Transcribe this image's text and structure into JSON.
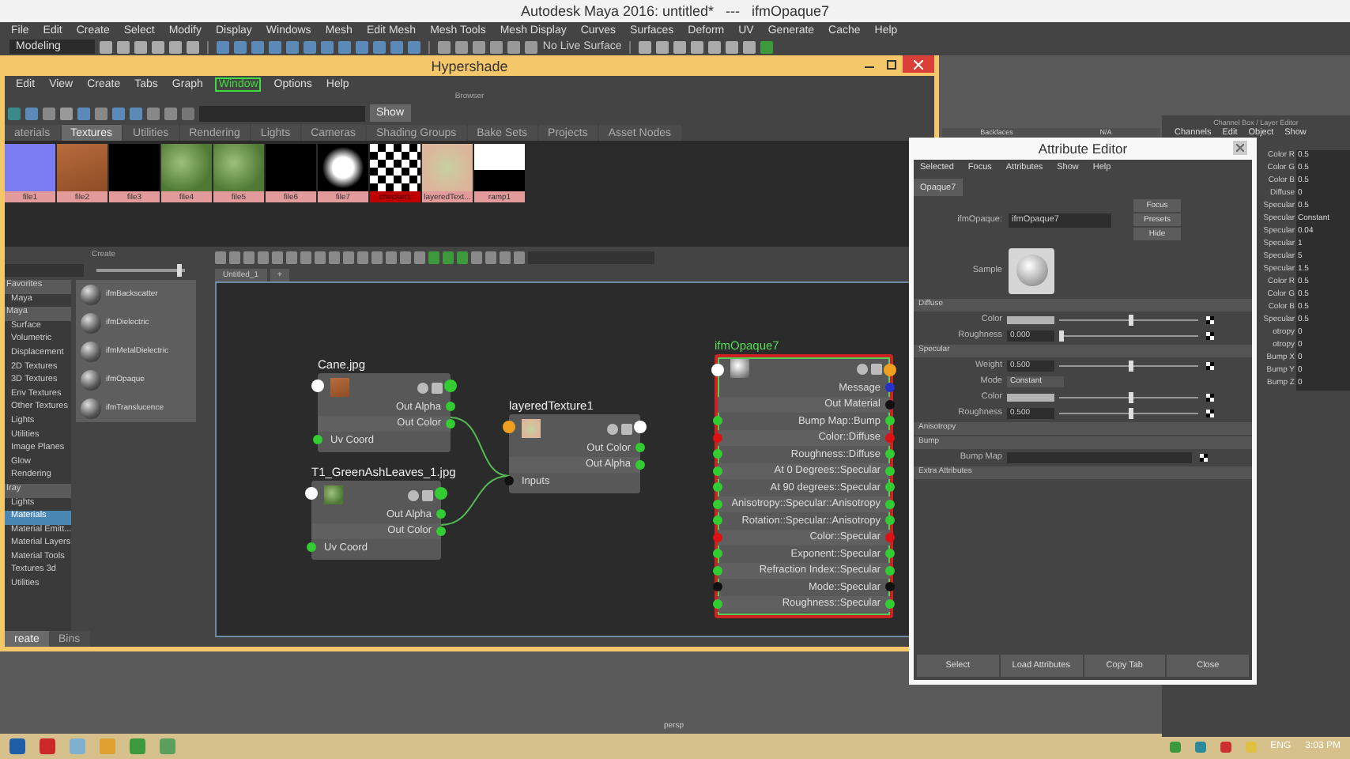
{
  "app": {
    "title": "Autodesk Maya 2016: untitled*   ---   ifmOpaque7",
    "menu": [
      "File",
      "Edit",
      "Create",
      "Select",
      "Modify",
      "Display",
      "Windows",
      "Mesh",
      "Edit Mesh",
      "Mesh Tools",
      "Mesh Display",
      "Curves",
      "Surfaces",
      "Deform",
      "UV",
      "Generate",
      "Cache",
      "Help"
    ],
    "mode": "Modeling",
    "live_surface": "No Live Surface"
  },
  "hypershade": {
    "title": "Hypershade",
    "menu": [
      {
        "label": "Edit",
        "highlighted": false
      },
      {
        "label": "View",
        "highlighted": false
      },
      {
        "label": "Create",
        "highlighted": false
      },
      {
        "label": "Tabs",
        "highlighted": false
      },
      {
        "label": "Graph",
        "highlighted": false
      },
      {
        "label": "Window",
        "highlighted": true
      },
      {
        "label": "Options",
        "highlighted": false
      },
      {
        "label": "Help",
        "highlighted": false
      }
    ],
    "browser_label": "Browser",
    "show_button": "Show",
    "tabs": [
      {
        "label": "aterials",
        "selected": false
      },
      {
        "label": "Textures",
        "selected": true
      },
      {
        "label": "Utilities",
        "selected": false
      },
      {
        "label": "Rendering",
        "selected": false
      },
      {
        "label": "Lights",
        "selected": false
      },
      {
        "label": "Cameras",
        "selected": false
      },
      {
        "label": "Shading Groups",
        "selected": false
      },
      {
        "label": "Bake Sets",
        "selected": false
      },
      {
        "label": "Projects",
        "selected": false
      },
      {
        "label": "Asset Nodes",
        "selected": false
      }
    ],
    "swatches": [
      {
        "label": "file1",
        "kind": "normal",
        "selected": false
      },
      {
        "label": "file2",
        "kind": "wood",
        "selected": false
      },
      {
        "label": "file3",
        "kind": "black",
        "selected": false
      },
      {
        "label": "file4",
        "kind": "leaves",
        "selected": false
      },
      {
        "label": "file5",
        "kind": "leaves",
        "selected": false
      },
      {
        "label": "file6",
        "kind": "black",
        "selected": false
      },
      {
        "label": "file7",
        "kind": "mask",
        "selected": false
      },
      {
        "label": "checker1",
        "kind": "checker",
        "selected": true
      },
      {
        "label": "layeredText...",
        "kind": "layered",
        "selected": false
      },
      {
        "label": "ramp1",
        "kind": "ramp",
        "selected": false
      }
    ],
    "create_panel": {
      "title": "Create",
      "size_slider": {
        "level": 0.95
      },
      "categories": [
        {
          "label": "Favorites",
          "kind": "header",
          "selected": false
        },
        {
          "label": "Maya",
          "kind": "item",
          "selected": false
        },
        {
          "label": "Maya",
          "kind": "header",
          "selected": false
        },
        {
          "label": "Surface",
          "kind": "item",
          "selected": false
        },
        {
          "label": "Volumetric",
          "kind": "item",
          "selected": false
        },
        {
          "label": "Displacement",
          "kind": "item",
          "selected": false
        },
        {
          "label": "2D Textures",
          "kind": "item",
          "selected": false
        },
        {
          "label": "3D Textures",
          "kind": "item",
          "selected": false
        },
        {
          "label": "Env Textures",
          "kind": "item",
          "selected": false
        },
        {
          "label": "Other Textures",
          "kind": "item",
          "selected": false
        },
        {
          "label": "Lights",
          "kind": "item",
          "selected": false
        },
        {
          "label": "Utilities",
          "kind": "item",
          "selected": false
        },
        {
          "label": "Image Planes",
          "kind": "item",
          "selected": false
        },
        {
          "label": "Glow",
          "kind": "item",
          "selected": false
        },
        {
          "label": "Rendering",
          "kind": "item",
          "selected": false
        },
        {
          "label": "Iray",
          "kind": "header",
          "selected": false
        },
        {
          "label": "Lights",
          "kind": "item",
          "selected": false
        },
        {
          "label": "Materials",
          "kind": "item",
          "selected": true
        },
        {
          "label": "Material Emitt...",
          "kind": "item",
          "selected": false
        },
        {
          "label": "Material Layers",
          "kind": "item",
          "selected": false
        },
        {
          "label": "Material Tools",
          "kind": "item",
          "selected": false
        },
        {
          "label": "Textures 3d",
          "kind": "item",
          "selected": false
        },
        {
          "label": "Utilities",
          "kind": "item",
          "selected": false
        }
      ],
      "materials": [
        "ifmBackscatter",
        "ifmDielectric",
        "ifmMetalDielectric",
        "ifmOpaque",
        "ifmTranslucence"
      ],
      "bottom_tabs": [
        {
          "label": "reate",
          "selected": true
        },
        {
          "label": "Bins",
          "selected": false
        }
      ]
    },
    "node_editor": {
      "tab": "Untitled_1",
      "add_tab": "+",
      "nodes": [
        {
          "title": "Cane.jpg",
          "selected": false,
          "kind": "wood",
          "in_port": {
            "color": "#ffffff"
          },
          "out_port": {
            "color": "#33cc33"
          },
          "ports": [
            {
              "label": "Out Alpha",
              "kind": "out",
              "color": "#33cc33"
            },
            {
              "label": "Out Color",
              "kind": "out",
              "color": "#33cc33"
            },
            {
              "label": "Uv Coord",
              "kind": "in",
              "color": "#33cc33"
            }
          ]
        },
        {
          "title": "T1_GreenAshLeaves_1.jpg",
          "selected": false,
          "kind": "leaves",
          "in_port": {
            "color": "#ffffff"
          },
          "out_port": {
            "color": "#33cc33"
          },
          "ports": [
            {
              "label": "Out Alpha",
              "kind": "out",
              "color": "#33cc33"
            },
            {
              "label": "Out Color",
              "kind": "out",
              "color": "#33cc33"
            },
            {
              "label": "Uv Coord",
              "kind": "in",
              "color": "#33cc33"
            }
          ]
        },
        {
          "title": "layeredTexture1",
          "selected": false,
          "kind": "layered",
          "in_port": {
            "color": "#f0a020"
          },
          "out_port": {
            "color": "#ffffff"
          },
          "ports": [
            {
              "label": "Out Color",
              "kind": "out",
              "color": "#33cc33"
            },
            {
              "label": "Out Alpha",
              "kind": "out",
              "color": "#33cc33"
            },
            {
              "label": "Inputs",
              "kind": "in",
              "color": "#111111"
            }
          ]
        },
        {
          "title": "ifmOpaque7",
          "selected": true,
          "kind": "sphere",
          "in_port": {
            "color": "#ffffff"
          },
          "out_port": {
            "color": "#f0a020"
          },
          "ports": [
            {
              "label": "Message",
              "kind": "out",
              "color": "#2233cc"
            },
            {
              "label": "Out Material",
              "kind": "out",
              "color": "#111111"
            },
            {
              "label": "Bump Map::Bump",
              "kind": "both",
              "color": "#33cc33"
            },
            {
              "label": "Color::Diffuse",
              "kind": "both",
              "color": "#dd1111"
            },
            {
              "label": "Roughness::Diffuse",
              "kind": "both",
              "color": "#33cc33"
            },
            {
              "label": "At 0 Degrees::Specular",
              "kind": "both",
              "color": "#33cc33"
            },
            {
              "label": "At 90 degrees::Specular",
              "kind": "both",
              "color": "#33cc33"
            },
            {
              "label": "Anisotropy::Specular::Anisotropy",
              "kind": "both",
              "color": "#33cc33"
            },
            {
              "label": "Rotation::Specular::Anisotropy",
              "kind": "both",
              "color": "#33cc33"
            },
            {
              "label": "Color::Specular",
              "kind": "both",
              "color": "#dd1111"
            },
            {
              "label": "Exponent::Specular",
              "kind": "both",
              "color": "#33cc33"
            },
            {
              "label": "Refraction Index::Specular",
              "kind": "both",
              "color": "#33cc33"
            },
            {
              "label": "Mode::Specular",
              "kind": "both",
              "color": "#111111"
            },
            {
              "label": "Roughness::Specular",
              "kind": "both",
              "color": "#33cc33"
            }
          ]
        }
      ]
    }
  },
  "outliner": {
    "column_1": "Backfaces",
    "column_2": "N/A"
  },
  "channel_box": {
    "title": "Channel Box / Layer Editor",
    "menu": [
      "Channels",
      "Edit",
      "Object",
      "Show"
    ],
    "rows": [
      {
        "label": "Color R",
        "value": "0.5"
      },
      {
        "label": "Color G",
        "value": "0.5"
      },
      {
        "label": "Color B",
        "value": "0.5"
      },
      {
        "label": "Diffuse",
        "value": "0"
      },
      {
        "label": "Specular",
        "value": "0.5"
      },
      {
        "label": "Specular",
        "value": "Constant"
      },
      {
        "label": "Specular",
        "value": "0.04"
      },
      {
        "label": "Specular",
        "value": "1"
      },
      {
        "label": "Specular",
        "value": "5"
      },
      {
        "label": "Specular",
        "value": "1.5"
      },
      {
        "label": "Color R",
        "value": "0.5"
      },
      {
        "label": "Color G",
        "value": "0.5"
      },
      {
        "label": "Color B",
        "value": "0.5"
      },
      {
        "label": "Specular",
        "value": "0.5"
      },
      {
        "label": "otropy",
        "value": "0"
      },
      {
        "label": "otropy",
        "value": "0"
      },
      {
        "label": "Bump X",
        "value": "0"
      },
      {
        "label": "Bump Y",
        "value": "0"
      },
      {
        "label": "Bump Z",
        "value": "0"
      }
    ]
  },
  "attribute_editor": {
    "title": "Attribute Editor",
    "menu": [
      "Selected",
      "Focus",
      "Attributes",
      "Show",
      "Help"
    ],
    "tab": "Opaque7",
    "node_label": "ifmOpaque:",
    "node_name": "ifmOpaque7",
    "buttons": [
      "Focus",
      "Presets",
      "Hide"
    ],
    "sample_label": "Sample",
    "sections": [
      {
        "title": "Diffuse",
        "rows": [
          {
            "kind": "color",
            "label": "Color",
            "level": 0.5
          },
          {
            "kind": "number",
            "label": "Roughness",
            "value": "0.000",
            "level": 0
          }
        ]
      },
      {
        "title": "Specular",
        "rows": [
          {
            "kind": "number",
            "label": "Weight",
            "value": "0.500",
            "level": 0.5
          },
          {
            "kind": "dropdown",
            "label": "Mode",
            "value": "Constant"
          },
          {
            "kind": "color",
            "label": "Color",
            "level": 0.5
          },
          {
            "kind": "number",
            "label": "Roughness",
            "value": "0.500",
            "level": 0.5
          }
        ]
      },
      {
        "title": "Anisotropy"
      },
      {
        "title": "Bump",
        "rows": [
          {
            "kind": "map",
            "label": "Bump Map"
          }
        ]
      },
      {
        "title": "Extra Attributes"
      }
    ],
    "footer": [
      "Select",
      "Load Attributes",
      "Copy Tab",
      "Close"
    ]
  },
  "viewport": {
    "camera": "persp"
  },
  "taskbar": {
    "language": "ENG",
    "time": "3:03 PM"
  }
}
